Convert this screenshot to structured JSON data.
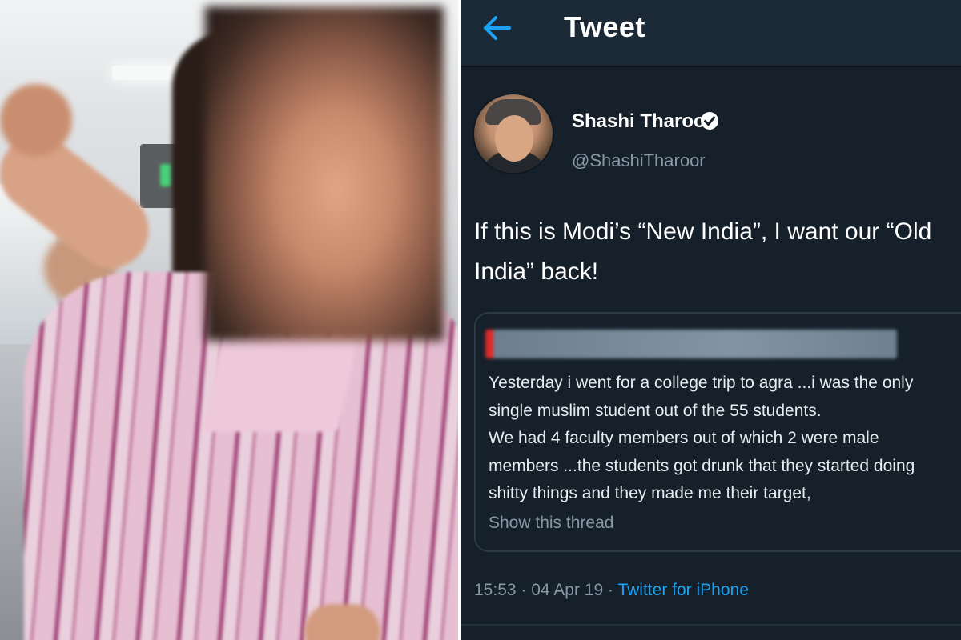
{
  "header": {
    "title": "Tweet"
  },
  "tweet": {
    "display_name": "Shashi Tharoor",
    "handle": "@ShashiTharoor",
    "text_lines": [
      "If this is Modi’s “New India”, I want our “Old",
      "India” back!"
    ],
    "quoted": {
      "lines": [
        "Yesterday i went for a college trip to agra ...i was the only",
        "single muslim student out of the 55 students.",
        "We had 4 faculty members out of which 2 were male",
        "members ...the students got drunk that they started doing",
        "shitty things and they made me their target,"
      ],
      "show_thread": "Show this thread"
    },
    "time": "15:53",
    "date": "04 Apr 19",
    "separator": "·",
    "source": "Twitter for iPhone"
  },
  "colors": {
    "background": "#15202b",
    "accent": "#1da1f2",
    "secondary_text": "#8899a6"
  },
  "icons": {
    "back": "back-arrow-icon",
    "verified": "verified-badge-icon"
  }
}
